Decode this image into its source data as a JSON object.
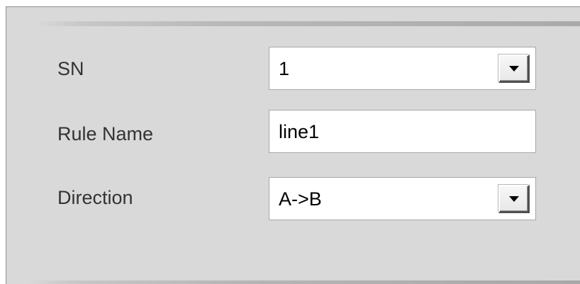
{
  "form": {
    "sn": {
      "label": "SN",
      "value": "1"
    },
    "rule_name": {
      "label": "Rule Name",
      "value": "line1"
    },
    "direction": {
      "label": "Direction",
      "value": "A->B"
    }
  },
  "icons": {
    "dropdown": "chevron-down-icon"
  },
  "colors": {
    "panel_background": "#d9d9d9",
    "field_background": "#ffffff",
    "label_text": "#333333",
    "value_text": "#000000",
    "field_border": "#a8a8a8"
  }
}
